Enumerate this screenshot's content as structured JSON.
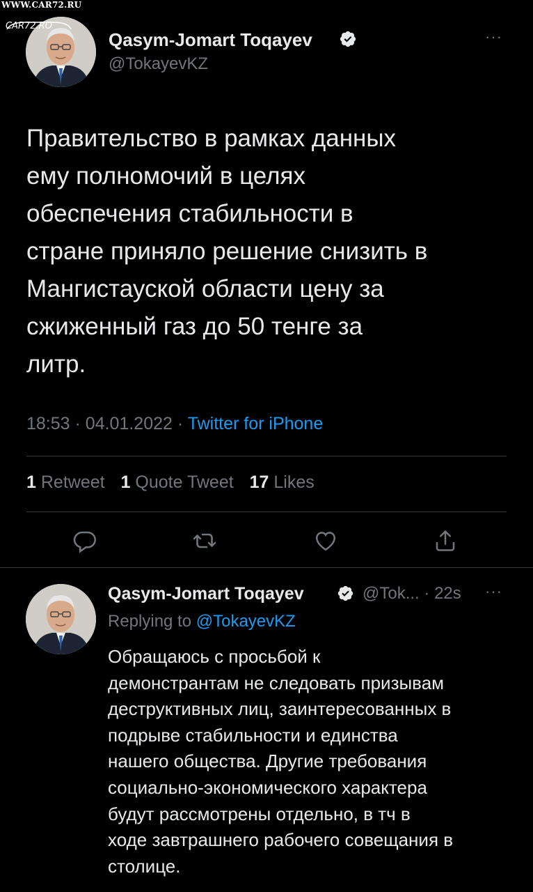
{
  "watermark": {
    "url": "WWW.CAR72.RU",
    "logo": "CAR72.RO"
  },
  "tweet": {
    "author_name": "Qasym-Jomart Toqayev",
    "author_handle": "@TokayevKZ",
    "more_label": "···",
    "text_lines": [
      "Правительство в рамках данных",
      "ему полномочий в целях",
      "обеспечения стабильности в",
      "стране приняло решение снизить в",
      "Мангистауской области цену за",
      "сжиженный газ до 50 тенге за",
      "литр."
    ],
    "time": "18:53",
    "date": "04.01.2022",
    "separator": "·",
    "source": "Twitter for iPhone",
    "stats": {
      "retweets_count": "1",
      "retweets_label": "Retweet",
      "quotes_count": "1",
      "quotes_label": "Quote Tweet",
      "likes_count": "17",
      "likes_label": "Likes"
    },
    "actions": [
      "reply-icon",
      "retweet-icon",
      "like-icon",
      "share-icon"
    ]
  },
  "reply": {
    "author_name": "Qasym-Jomart Toqayev",
    "handle_truncated": "@Tok...",
    "separator": "·",
    "age": "22s",
    "more_label": "···",
    "replying_prefix": "Replying to",
    "replying_mention": "@TokayevKZ",
    "text_lines": [
      "Обращаюсь с просьбой к",
      "демонстрантам не следовать призывам",
      "деструктивных лиц, заинтересованных в",
      "подрыве стабильности и единства",
      "нашего общества. Другие требования",
      "социально-экономического характера",
      "будут рассмотрены отдельно, в тч в",
      "ходе завтрашнего рабочего совещания в",
      "столице."
    ]
  },
  "colors": {
    "background": "#000000",
    "text": "#e7e9ea",
    "secondary": "#71767b",
    "accent": "#1d9bf0",
    "divider": "#2f3336"
  }
}
